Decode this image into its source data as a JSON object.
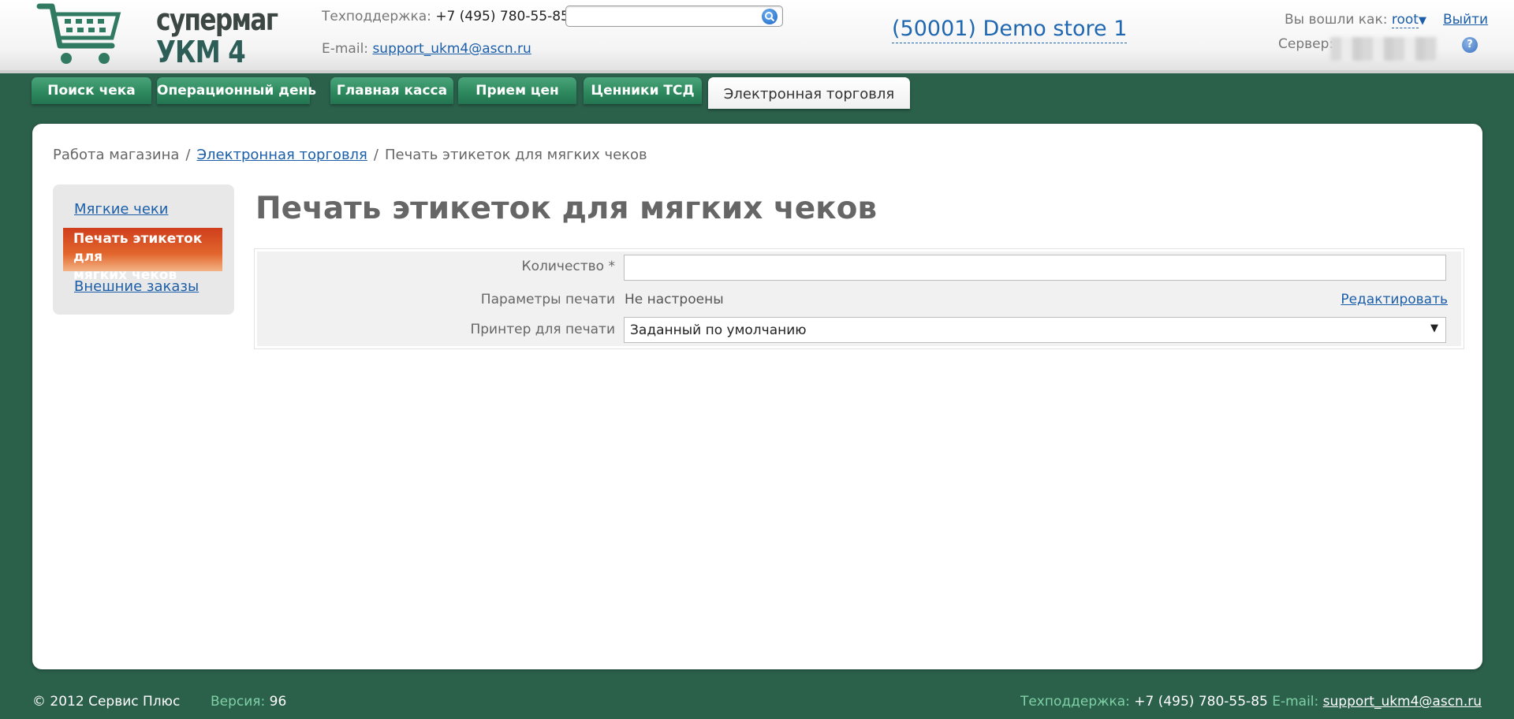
{
  "header": {
    "logo": {
      "line1": "супермаг",
      "line2": "УКМ 4"
    },
    "support_label": "Техподдержка:",
    "support_phone": "+7 (495) 780-55-85",
    "email_label": "E-mail:",
    "email": "support_ukm4@ascn.ru",
    "search_placeholder": "",
    "store": "(50001) Demo store 1",
    "logged_in_label": "Вы вошли как:",
    "user": "root",
    "logout": "Выйти",
    "server_label": "Сервер:",
    "help": "?"
  },
  "tabs": [
    {
      "label": "Поиск чека"
    },
    {
      "label": "Операционный день"
    },
    {
      "label": "Главная касса"
    },
    {
      "label": "Прием цен"
    },
    {
      "label": "Ценники ТСД"
    },
    {
      "label": "Электронная торговля"
    }
  ],
  "breadcrumb": {
    "root": "Работа магазина",
    "section": "Электронная торговля",
    "current": "Печать этикеток для мягких чеков",
    "separator": "/"
  },
  "side_menu": {
    "items": [
      {
        "label": "Мягкие чеки"
      },
      {
        "label_line1": "Печать этикеток для",
        "label_line2": "мягких чеков"
      },
      {
        "label": "Внешние заказы"
      }
    ]
  },
  "main": {
    "title": "Печать этикеток для мягких чеков",
    "form": {
      "quantity_label": "Количество *",
      "quantity_value": "",
      "print_params_label": "Параметры печати",
      "print_params_value": "Не настроены",
      "edit_link": "Редактировать",
      "printer_label": "Принтер для печати",
      "printer_value": "Заданный по умолчанию"
    }
  },
  "footer": {
    "copyright": "© 2012 Сервис Плюс",
    "version_label": "Версия:",
    "version": "96",
    "support_label": "Техподдержка:",
    "support_phone": "+7 (495) 780-55-85",
    "email_label": "E-mail:",
    "email": "support_ukm4@ascn.ru"
  },
  "colors": {
    "background": "#2b604b",
    "tab_green": "#2e8a5e",
    "active_menu": "#d9471f",
    "link": "#1b5ea8"
  }
}
